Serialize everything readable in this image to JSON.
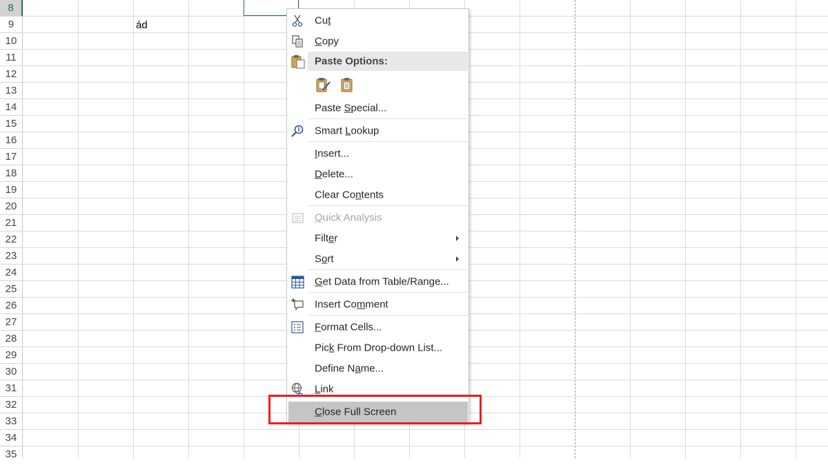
{
  "sheet": {
    "rows": [
      "8",
      "9",
      "10",
      "11",
      "12",
      "13",
      "14",
      "15",
      "16",
      "17",
      "18",
      "19",
      "20",
      "21",
      "22",
      "23",
      "24",
      "25",
      "26",
      "27",
      "28",
      "29",
      "30",
      "31",
      "32",
      "33",
      "34",
      "35"
    ],
    "active_row": "8",
    "cell_text": "ád"
  },
  "menu": {
    "cut": {
      "pre": "Cu",
      "key": "t",
      "post": ""
    },
    "copy": {
      "pre": "",
      "key": "C",
      "post": "opy"
    },
    "paste_options": "Paste Options:",
    "paste_special": {
      "pre": "Paste ",
      "key": "S",
      "post": "pecial..."
    },
    "smart_lookup": {
      "pre": "Smart ",
      "key": "L",
      "post": "ookup"
    },
    "insert": {
      "pre": "",
      "key": "I",
      "post": "nsert..."
    },
    "delete": {
      "pre": "",
      "key": "D",
      "post": "elete..."
    },
    "clear_contents": {
      "pre": "Clear Co",
      "key": "n",
      "post": "tents"
    },
    "quick_analysis": {
      "pre": "",
      "key": "Q",
      "post": "uick Analysis"
    },
    "filter": {
      "pre": "Filt",
      "key": "e",
      "post": "r"
    },
    "sort": {
      "pre": "S",
      "key": "o",
      "post": "rt"
    },
    "get_data": {
      "pre": "",
      "key": "G",
      "post": "et Data from Table/Range..."
    },
    "insert_comment": {
      "pre": "Insert Co",
      "key": "m",
      "post": "ment"
    },
    "format_cells": {
      "pre": "",
      "key": "F",
      "post": "ormat Cells..."
    },
    "pick_list": {
      "pre": "Pic",
      "key": "k",
      "post": " From Drop-down List..."
    },
    "define_name": {
      "pre": "Define N",
      "key": "a",
      "post": "me..."
    },
    "link": {
      "pre": "",
      "key": "L",
      "post": "ink"
    },
    "close_full_screen": {
      "pre": "",
      "key": "C",
      "post": "lose Full Screen"
    }
  },
  "colors": {
    "accent": "#217346",
    "highlight_box": "#ee1c1c"
  }
}
